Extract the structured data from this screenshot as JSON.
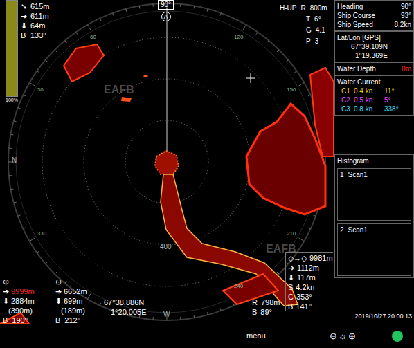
{
  "sonar": {
    "heading_mark": "90°",
    "bow_mark": "A",
    "mode": "H-UP",
    "settings": [
      {
        "label": "R",
        "value": "800m"
      },
      {
        "label": "T",
        "value": "6°"
      },
      {
        "label": "G",
        "value": "4.1"
      },
      {
        "label": "P",
        "value": "3"
      }
    ],
    "gain_bar": {
      "label": "100%",
      "level": 1
    },
    "target": [
      {
        "icon": "➘",
        "value": "615m"
      },
      {
        "icon": "➔",
        "value": "611m"
      },
      {
        "icon": "⬇",
        "value": "64m"
      },
      {
        "icon": "B",
        "value": "133°"
      }
    ],
    "bezel_labels": [
      "30",
      "60",
      "120",
      "150",
      "210",
      "240",
      "330"
    ],
    "ring_labels": [
      "N",
      "W",
      "400"
    ],
    "watermarks": [
      "EAFB",
      "EAFB"
    ]
  },
  "cursors": [
    {
      "icon": "⊕",
      "range_icon": "➔",
      "range": "9999m",
      "range_color": "#ff2a2a",
      "depth_icon": "⬇",
      "horizontal": "2884m",
      "depth": "(390m)",
      "bearing_label": "B",
      "bearing": "190°"
    },
    {
      "icon": "⊙",
      "range_icon": "➔",
      "range": "6652m",
      "range_color": "#ffffff",
      "depth_icon": "⬇",
      "horizontal": "699m",
      "depth": "(189m)",
      "bearing_label": "B",
      "bearing": "212°"
    }
  ],
  "cursor_position": {
    "lat": "67°38.886N",
    "lon": "1°20.005E",
    "range_label": "R",
    "range": "798m",
    "bearing_label": "B",
    "bearing": "89°"
  },
  "track_box": [
    {
      "icon": "◇→◇",
      "value": "9981m"
    },
    {
      "icon": "➔",
      "value": "1112m"
    },
    {
      "icon": "⬇",
      "value": "117m"
    },
    {
      "icon": "S",
      "value": "4.2kn"
    },
    {
      "icon": "C",
      "value": "353°"
    },
    {
      "icon": "B",
      "value": "141°"
    }
  ],
  "ship": [
    {
      "label": "Heading",
      "value": "90°"
    },
    {
      "label": "Ship Course",
      "value": "93°"
    },
    {
      "label": "Ship Speed",
      "value": "8.2kn"
    }
  ],
  "position": {
    "title": "Lat/Lon [GPS]",
    "lat": "67°39.109N",
    "lon": "1°19.369E"
  },
  "water_depth": {
    "label": "Water Depth",
    "value": "0m"
  },
  "water_current": {
    "title": "Water Current",
    "items": [
      {
        "name": "C1",
        "speed": "0.4 kn",
        "direction": "11°",
        "color": "#ffd800"
      },
      {
        "name": "C2",
        "speed": "0.5 kn",
        "direction": "5°",
        "color": "#ff40ff"
      },
      {
        "name": "C3",
        "speed": "0.8 kn",
        "direction": "338°",
        "color": "#3fe0ff"
      }
    ]
  },
  "histogram": {
    "title": "Histogram",
    "scans": [
      {
        "index": "1",
        "label": "Scan1"
      },
      {
        "index": "2",
        "label": "Scan1"
      }
    ]
  },
  "timestamp": "2019/10/27 20:00:13",
  "bottom_bar": {
    "menu": "menu",
    "zoom": [
      "⊖",
      "☼",
      "⊕"
    ],
    "status_on": true
  }
}
